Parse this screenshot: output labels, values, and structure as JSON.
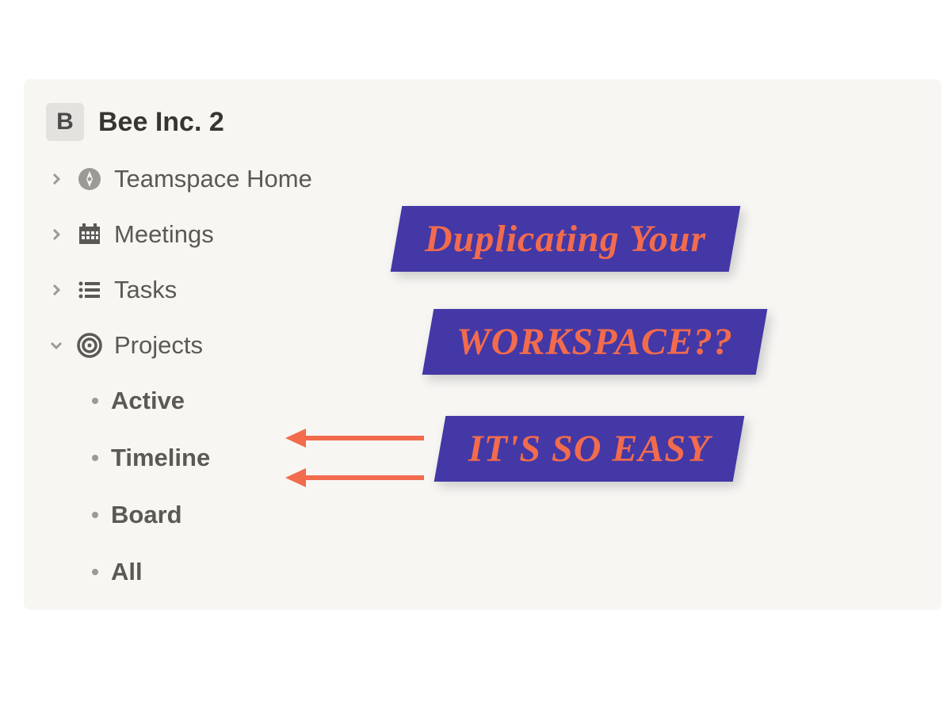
{
  "workspace": {
    "icon_letter": "B",
    "name": "Bee Inc. 2"
  },
  "sidebar": {
    "items": [
      {
        "label": "Teamspace Home",
        "icon": "compass",
        "expanded": false,
        "children": []
      },
      {
        "label": "Meetings",
        "icon": "calendar",
        "expanded": false,
        "children": []
      },
      {
        "label": "Tasks",
        "icon": "list",
        "expanded": false,
        "children": []
      },
      {
        "label": "Projects",
        "icon": "target",
        "expanded": true,
        "children": [
          {
            "label": "Active"
          },
          {
            "label": "Timeline"
          },
          {
            "label": "Board"
          },
          {
            "label": "All"
          }
        ]
      }
    ]
  },
  "annotations": {
    "line1": "Duplicating Your",
    "line2": "WORKSPACE??",
    "line3": "IT'S SO EASY"
  },
  "colors": {
    "annotation_bg": "#4338a6",
    "annotation_text": "#f26b4d",
    "panel_bg": "#f7f6f3"
  }
}
